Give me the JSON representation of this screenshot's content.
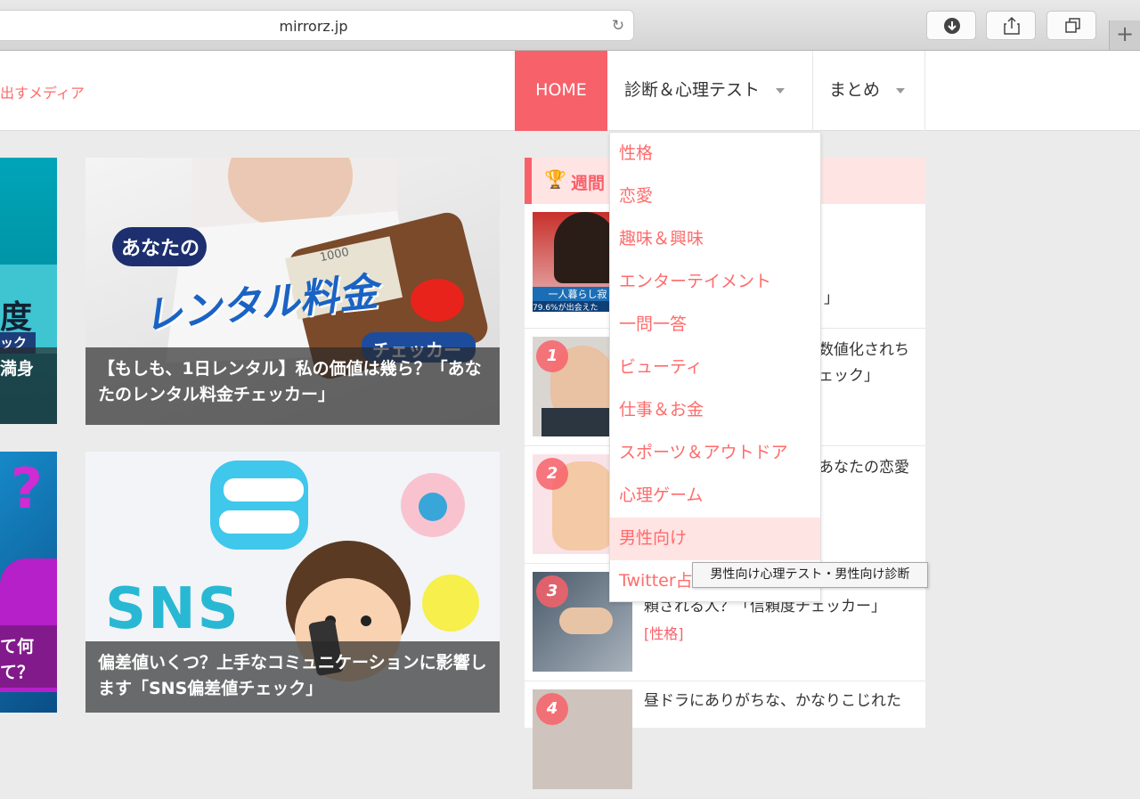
{
  "browser": {
    "url": "mirrorz.jp",
    "reload_icon": "↻",
    "new_tab_glyph": "+"
  },
  "header": {
    "tagline": "出すメディア",
    "nav": {
      "home": "HOME",
      "shindan": "診断＆心理テスト",
      "matome": "まとめ"
    }
  },
  "left_column": {
    "card_a_caption_1": "満身",
    "card_a_badge": "ック",
    "card_a_glyph": "度",
    "card_b_caption_1": "て何",
    "card_b_caption_2": "て？",
    "card_b_glyph": "?"
  },
  "main_cards": [
    {
      "caption": "【もしも、1日レンタル】私の価値は幾ら？「あなたのレンタル料金チェッカー」",
      "art_bubble": "あなたの",
      "art_title": "レンタル料金",
      "art_sub": "チェッカー",
      "art_bill": "1000"
    },
    {
      "caption": "偏差値いくつ？上手なコミュニケーションに影響します「SNS偏差値チェック」",
      "art_title": "SNS"
    }
  ],
  "sidebar": {
    "title": "週間",
    "rows": [
      {
        "rank": "",
        "lines": [
          "」"
        ],
        "tag": "",
        "thumb_caption": "一人暮らし寂し",
        "thumb_sub": "79.6%が出会えた"
      },
      {
        "rank": "1",
        "lines": [
          "数値化されち",
          "ェック」"
        ],
        "tag": ""
      },
      {
        "rank": "2",
        "lines": [
          "あなたの恋愛"
        ],
        "tag": ""
      },
      {
        "rank": "3",
        "lines": [
          "頼される人？「信頼度チェッカー」"
        ],
        "tag": "[性格]"
      },
      {
        "rank": "4",
        "lines": [
          "昼ドラにありがちな、かなりこじれた"
        ],
        "tag": ""
      }
    ]
  },
  "dropdown": {
    "items": [
      "性格",
      "恋愛",
      "趣味＆興味",
      "エンターテイメント",
      "一問一答",
      "ビューティ",
      "仕事＆お金",
      "スポーツ＆アウトドア",
      "心理ゲーム",
      "男性向け",
      "Twitter占"
    ],
    "highlighted_index": 9
  },
  "tooltip": "男性向け心理テスト・男性向け診断",
  "colors": {
    "accent": "#f7616a",
    "link": "#ff6b6b",
    "highlight_bg": "#ffe4e4"
  }
}
